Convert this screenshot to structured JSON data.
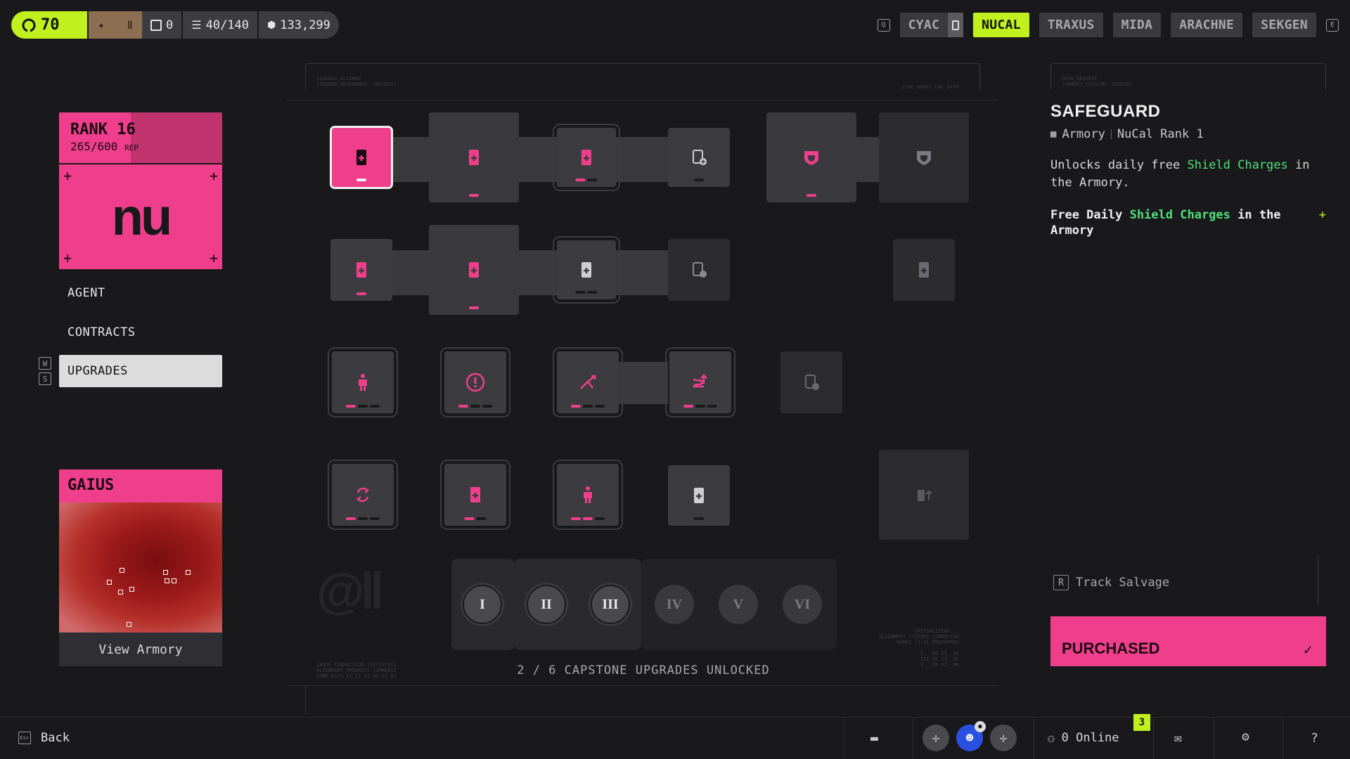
{
  "topbar": {
    "level": "70",
    "brown_glyph_1": "✦",
    "brown_glyph_2": "Ⅱ",
    "inbox_count": "0",
    "stash": "40/140",
    "credits": "133,299"
  },
  "factions": {
    "prev_key": "Q",
    "next_key": "E",
    "items": [
      {
        "label": "CYAC",
        "active": false
      },
      {
        "label": "NUCAL",
        "active": true
      },
      {
        "label": "TRAXUS",
        "active": false
      },
      {
        "label": "MIDA",
        "active": false
      },
      {
        "label": "ARACHNE",
        "active": false
      },
      {
        "label": "SEKGEN",
        "active": false
      }
    ]
  },
  "rank": {
    "title": "RANK 16",
    "progress": "265/600",
    "progress_unit": "REP",
    "progress_fraction": 0.44,
    "logo": "nu"
  },
  "menu": {
    "items": [
      "AGENT",
      "CONTRACTS",
      "UPGRADES"
    ],
    "active": "UPGRADES",
    "key_up": "W",
    "key_down": "S"
  },
  "handler": {
    "name": "GAIUS",
    "button": "View Armory"
  },
  "capstones": {
    "numerals": [
      "I",
      "II",
      "III",
      "IV",
      "V",
      "VI"
    ],
    "unlocked_count": 3,
    "label": "2 / 6 CAPSTONE UPGRADES UNLOCKED"
  },
  "detail": {
    "title": "SAFEGUARD",
    "meta_location": "Armory",
    "meta_requirement": "NuCal Rank 1",
    "desc_prefix": "Unlocks daily free ",
    "desc_highlight": "Shield Charges",
    "desc_suffix": " in the Armory.",
    "perk_prefix": "Free Daily ",
    "perk_highlight": "Shield Charges",
    "perk_suffix": " in the Armory",
    "perk_plus": "+"
  },
  "actions": {
    "track_key": "R",
    "track_label": "Track Salvage",
    "purchase_label": "PURCHASED",
    "purchase_check": "✓"
  },
  "bottombar": {
    "back_key": "Esc",
    "back_label": "Back",
    "online_label": "0 Online",
    "notification_count": "3"
  },
  "colors": {
    "accent_pink": "#ef3f8c",
    "accent_lime": "#c0f01e",
    "highlight_green": "#4ee07b",
    "background": "#19191b"
  },
  "icons": {
    "node_types": [
      "shield-charge-icon",
      "shield-badge-icon",
      "consumable-slot-icon",
      "agent-upgrade-icon",
      "alert-icon",
      "route-split-icon",
      "route-loop-icon",
      "swap-icon"
    ]
  }
}
